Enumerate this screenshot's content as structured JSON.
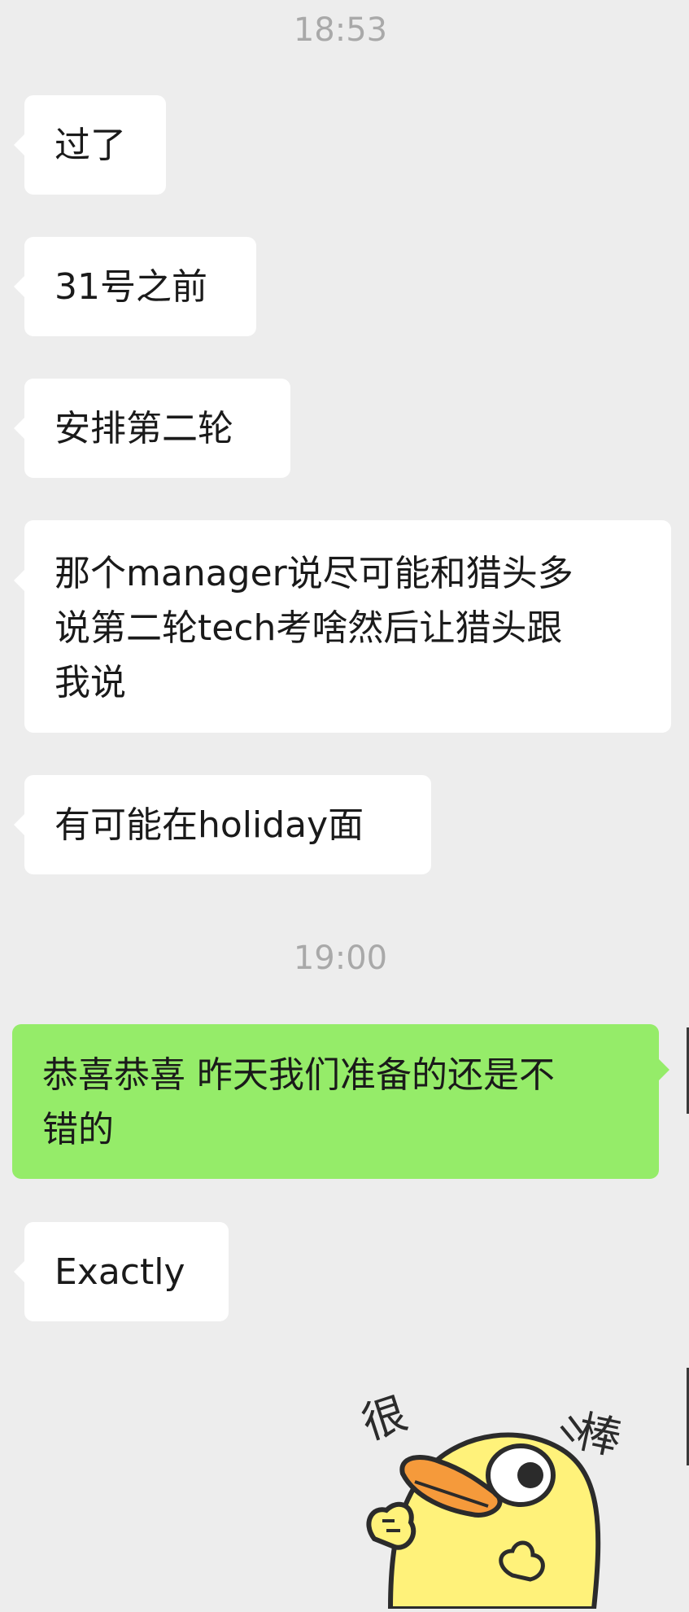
{
  "messages": [
    {
      "type": "time",
      "text": "18:53"
    },
    {
      "type": "in",
      "text": "过了"
    },
    {
      "type": "in",
      "text": "31号之前"
    },
    {
      "type": "in",
      "text": "安排第二轮"
    },
    {
      "type": "in",
      "lines": [
        "那个manager说尽可能和猎头多",
        "说第二轮tech考啥然后让猎头跟",
        "我说"
      ]
    },
    {
      "type": "in",
      "text": "有可能在holiday面"
    },
    {
      "type": "time",
      "text": "19:00"
    },
    {
      "type": "out",
      "lines": [
        "恭喜恭喜 昨天我们准备的还是不",
        "错的"
      ]
    },
    {
      "type": "in",
      "text": "Exactly"
    },
    {
      "type": "sticker",
      "name": "duck-sticker",
      "text": [
        "很",
        "棒"
      ],
      "colors": {
        "body": "#fff27a",
        "beak": "#f59a3b",
        "outline": "#2b2b2b"
      }
    }
  ],
  "colors": {
    "background": "#ededed",
    "incoming_bubble": "#ffffff",
    "outgoing_bubble": "#95ec69",
    "timestamp": "#a9a9a9"
  }
}
